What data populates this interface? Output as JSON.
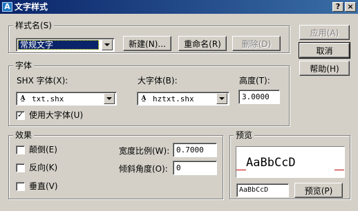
{
  "window": {
    "icon": "autocad-icon",
    "title": "文字样式",
    "help_glyph": "?",
    "close_glyph": "×"
  },
  "style_name_group": {
    "title": "样式名(S)",
    "selected": "常规文字",
    "new_button": "新建(N)...",
    "rename_button": "重命名(R)",
    "delete_button": "删除(D)"
  },
  "side_buttons": {
    "apply": "应用(A)",
    "cancel": "取消",
    "help": "帮助(H)"
  },
  "font_group": {
    "title": "字体",
    "shx_label": "SHX 字体(X):",
    "shx_value": "txt.shx",
    "big_font_label": "大字体(B):",
    "big_font_value": "hztxt.shx",
    "height_label": "高度(T):",
    "height_value": "3.0000",
    "use_big_font_label": "使用大字体(U)",
    "use_big_font_checked": true
  },
  "effects_group": {
    "title": "效果",
    "upside_down_label": "颠倒(E)",
    "upside_down_checked": false,
    "backwards_label": "反向(K)",
    "backwards_checked": false,
    "vertical_label": "垂直(V)",
    "vertical_checked": false,
    "width_factor_label": "宽度比例(W):",
    "width_factor_value": "0.7000",
    "oblique_angle_label": "倾斜角度(O):",
    "oblique_angle_value": "0"
  },
  "preview_group": {
    "title": "预览",
    "sample_text": "AaBbCcD",
    "preview_input_value": "AaBbCcD",
    "preview_button": "预览(P)"
  },
  "colors": {
    "dialog_bg": "#d4d0c8",
    "title_gradient_start": "#0a246a",
    "title_gradient_end": "#3a6ea5",
    "selection": "#0a246a",
    "preview_baseline": "#c00000"
  }
}
